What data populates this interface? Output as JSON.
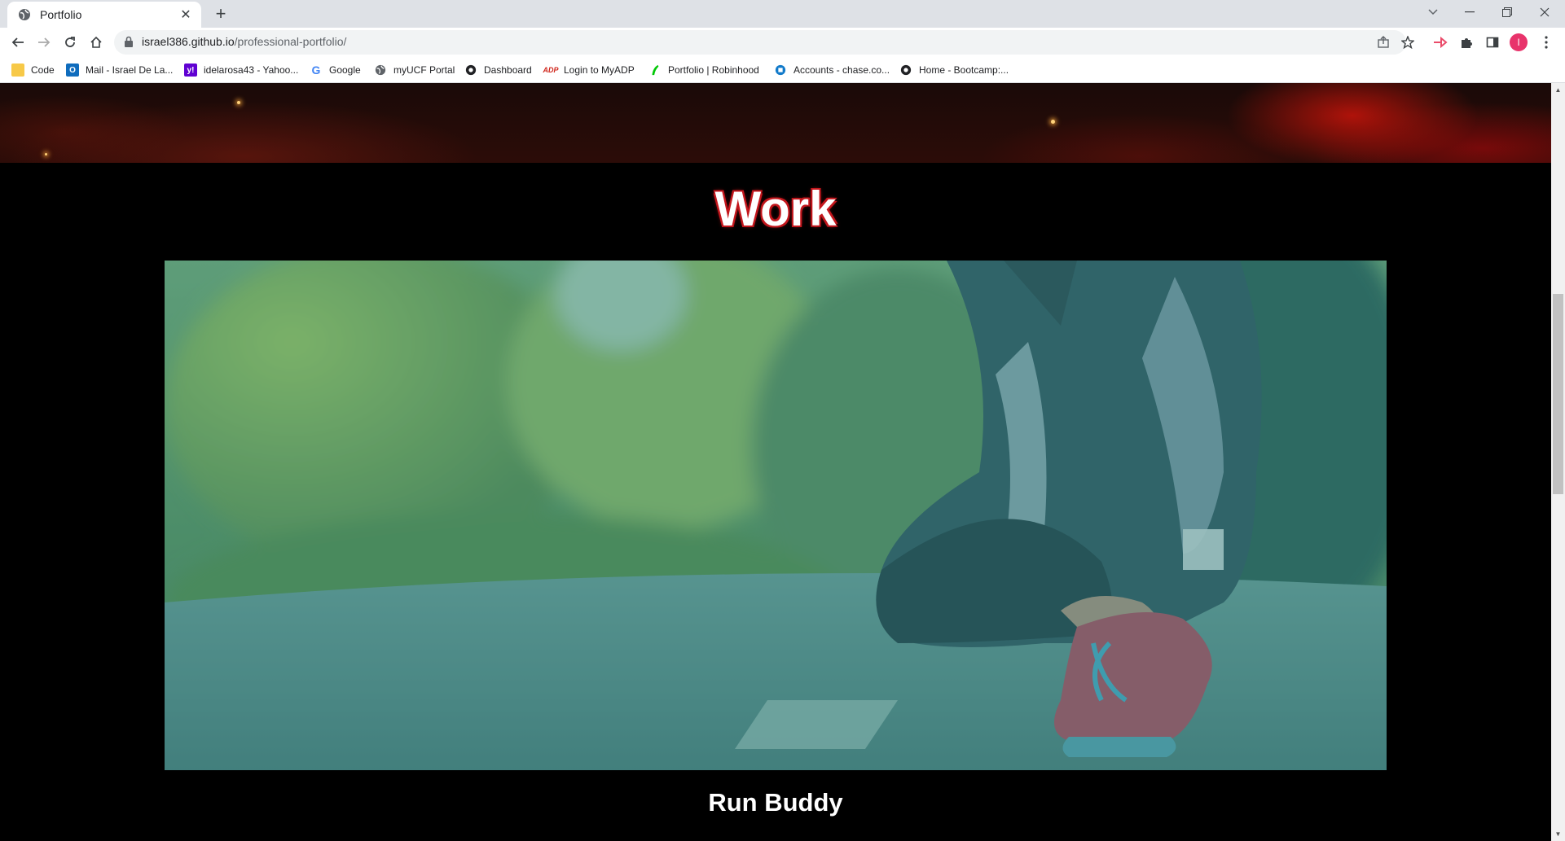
{
  "browser": {
    "tab": {
      "title": "Portfolio",
      "favicon": "globe-icon"
    },
    "address": {
      "host": "israel386.github.io",
      "path": "/professional-portfolio/"
    },
    "profile_initial": "I",
    "bookmarks": [
      {
        "label": "Code",
        "icon": "folder-icon",
        "color": "#f7c948"
      },
      {
        "label": "Mail - Israel De La...",
        "icon": "outlook-icon",
        "color": "#0f6cbd"
      },
      {
        "label": "idelarosa43 - Yahoo...",
        "icon": "yahoo-icon",
        "color": "#6001d2"
      },
      {
        "label": "Google",
        "icon": "google-icon",
        "color": "#4285f4"
      },
      {
        "label": "myUCF Portal",
        "icon": "globe-icon",
        "color": "#5f6368"
      },
      {
        "label": "Dashboard",
        "icon": "canvas-icon",
        "color": "#202124"
      },
      {
        "label": "Login to MyADP",
        "icon": "adp-icon",
        "color": "#d0271d"
      },
      {
        "label": "Portfolio | Robinhood",
        "icon": "robinhood-icon",
        "color": "#00c805"
      },
      {
        "label": "Accounts - chase.co...",
        "icon": "chase-icon",
        "color": "#117aca"
      },
      {
        "label": "Home - Bootcamp:...",
        "icon": "canvas-icon",
        "color": "#202124"
      }
    ]
  },
  "page": {
    "section_title": "Work",
    "projects": [
      {
        "title": "Run Buddy",
        "image": "runner-tying-shoe-photo"
      }
    ]
  },
  "colors": {
    "accent_red": "#c4161c",
    "page_bg": "#000000",
    "image_overlay": "#2a8a86"
  }
}
